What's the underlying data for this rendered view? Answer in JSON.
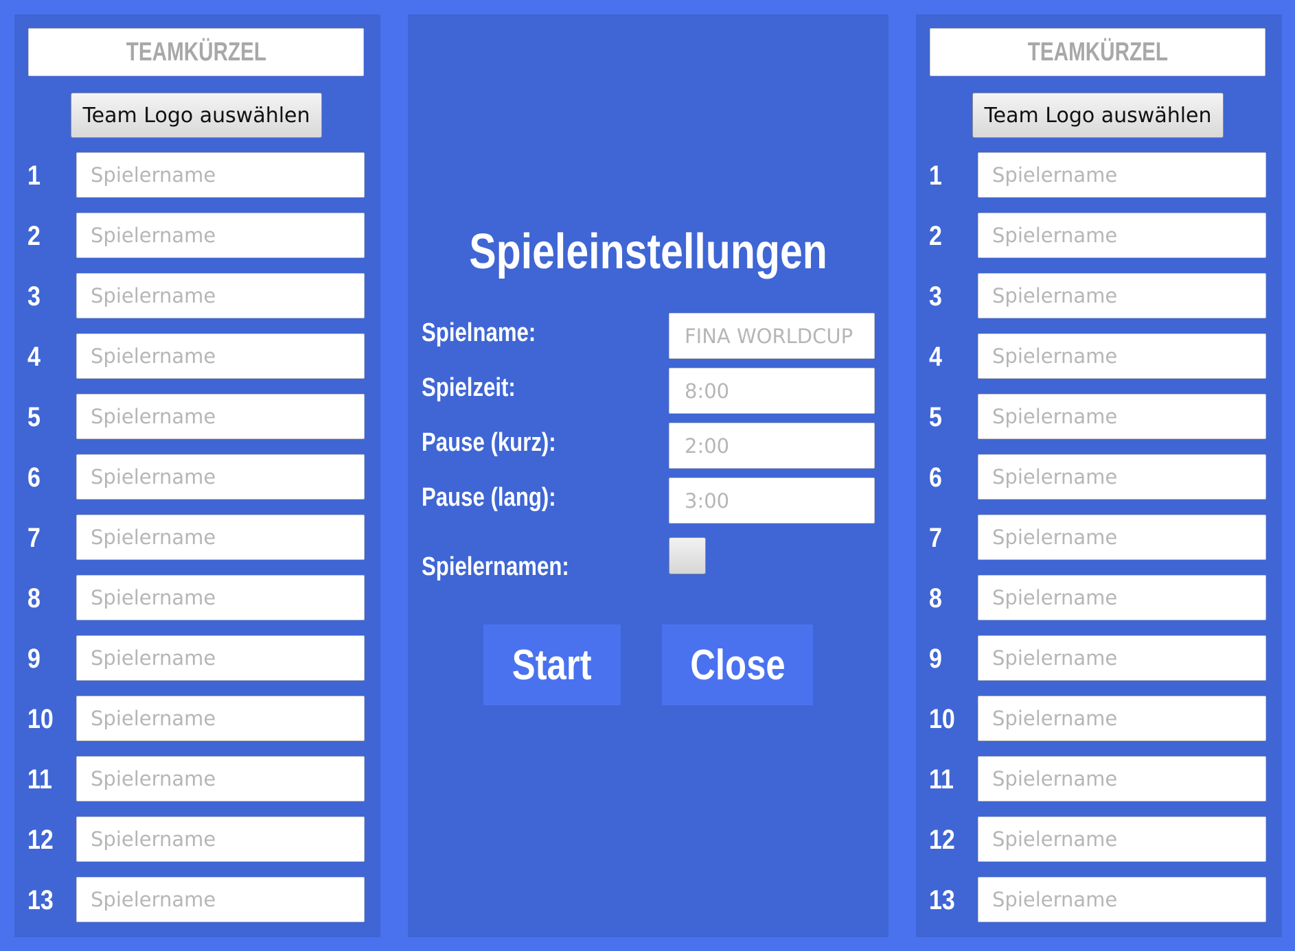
{
  "left_team": {
    "abbr_label": "TEAMKÜRZEL",
    "logo_button_label": "Team Logo auswählen",
    "players": [
      {
        "number": "1",
        "placeholder": "Spielername"
      },
      {
        "number": "2",
        "placeholder": "Spielername"
      },
      {
        "number": "3",
        "placeholder": "Spielername"
      },
      {
        "number": "4",
        "placeholder": "Spielername"
      },
      {
        "number": "5",
        "placeholder": "Spielername"
      },
      {
        "number": "6",
        "placeholder": "Spielername"
      },
      {
        "number": "7",
        "placeholder": "Spielername"
      },
      {
        "number": "8",
        "placeholder": "Spielername"
      },
      {
        "number": "9",
        "placeholder": "Spielername"
      },
      {
        "number": "10",
        "placeholder": "Spielername"
      },
      {
        "number": "11",
        "placeholder": "Spielername"
      },
      {
        "number": "12",
        "placeholder": "Spielername"
      },
      {
        "number": "13",
        "placeholder": "Spielername"
      }
    ]
  },
  "right_team": {
    "abbr_label": "TEAMKÜRZEL",
    "logo_button_label": "Team Logo auswählen",
    "players": [
      {
        "number": "1",
        "placeholder": "Spielername"
      },
      {
        "number": "2",
        "placeholder": "Spielername"
      },
      {
        "number": "3",
        "placeholder": "Spielername"
      },
      {
        "number": "4",
        "placeholder": "Spielername"
      },
      {
        "number": "5",
        "placeholder": "Spielername"
      },
      {
        "number": "6",
        "placeholder": "Spielername"
      },
      {
        "number": "7",
        "placeholder": "Spielername"
      },
      {
        "number": "8",
        "placeholder": "Spielername"
      },
      {
        "number": "9",
        "placeholder": "Spielername"
      },
      {
        "number": "10",
        "placeholder": "Spielername"
      },
      {
        "number": "11",
        "placeholder": "Spielername"
      },
      {
        "number": "12",
        "placeholder": "Spielername"
      },
      {
        "number": "13",
        "placeholder": "Spielername"
      }
    ]
  },
  "settings": {
    "title": "Spieleinstellungen",
    "game_name": {
      "label": "Spielname:",
      "placeholder": "FINA WORLDCUP"
    },
    "game_time": {
      "label": "Spielzeit:",
      "placeholder": "8:00"
    },
    "pause_short": {
      "label": "Pause (kurz):",
      "placeholder": "2:00"
    },
    "pause_long": {
      "label": "Pause (lang):",
      "placeholder": "3:00"
    },
    "player_names": {
      "label": "Spielernamen:",
      "checked": false
    },
    "start_label": "Start",
    "close_label": "Close"
  },
  "colors": {
    "background": "#4a72ee",
    "panel": "#3f66d4",
    "button_accent": "#4a72ee"
  }
}
